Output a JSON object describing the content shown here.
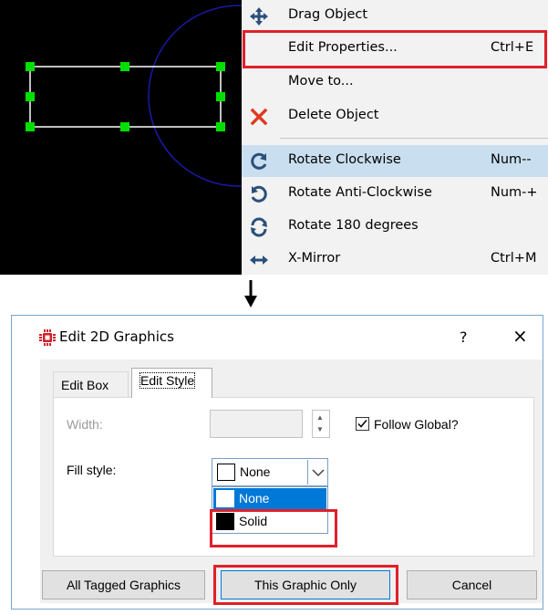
{
  "context_menu": {
    "items": [
      {
        "label": "Drag Object",
        "shortcut": "",
        "icon": "move-cross-icon"
      },
      {
        "label": "Edit Properties...",
        "shortcut": "Ctrl+E",
        "icon": ""
      },
      {
        "label": "Move to...",
        "shortcut": "",
        "icon": ""
      },
      {
        "label": "Delete Object",
        "shortcut": "",
        "icon": "delete-x-icon"
      },
      {
        "label": "Rotate Clockwise",
        "shortcut": "Num--",
        "icon": "rotate-clockwise-icon"
      },
      {
        "label": "Rotate Anti-Clockwise",
        "shortcut": "Num-+",
        "icon": "rotate-anticlockwise-icon"
      },
      {
        "label": "Rotate 180 degrees",
        "shortcut": "",
        "icon": "rotate-180-icon"
      },
      {
        "label": "X-Mirror",
        "shortcut": "Ctrl+M",
        "icon": "mirror-x-icon"
      }
    ],
    "highlighted": "Rotate Clockwise"
  },
  "dialog": {
    "title": "Edit 2D Graphics",
    "help": "?",
    "close": "×",
    "tabs": [
      {
        "label": "Edit Box",
        "active": false
      },
      {
        "label": "Edit Style",
        "active": true
      }
    ],
    "width_label": "Width:",
    "width_value": "",
    "follow_global_label": "Follow Global?",
    "follow_global_checked": true,
    "fill_style_label": "Fill style:",
    "fill_style_value": "None",
    "fill_options": [
      "None",
      "Solid"
    ],
    "buttons": {
      "all_tagged": "All Tagged Graphics",
      "this_only": "This Graphic Only",
      "cancel": "Cancel"
    }
  },
  "colors": {
    "highlight_frame": "#e0202a",
    "menu_highlight": "#c9dfef",
    "selection_blue": "#0078d7",
    "handle_green": "#00e000"
  }
}
